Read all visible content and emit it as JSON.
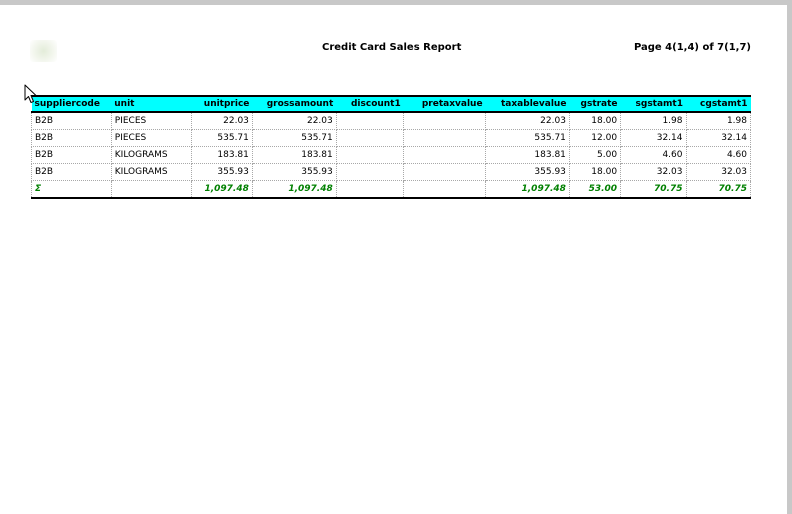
{
  "report": {
    "title": "Credit Card Sales Report",
    "page_indicator": "Page 4(1,4) of 7(1,7)"
  },
  "table": {
    "columns": [
      {
        "key": "suppliercode",
        "label": "suppliercode",
        "align": "left"
      },
      {
        "key": "unit",
        "label": "unit",
        "align": "left"
      },
      {
        "key": "unitprice",
        "label": "unitprice",
        "align": "right"
      },
      {
        "key": "grossamount",
        "label": "grossamount",
        "align": "right"
      },
      {
        "key": "discount1",
        "label": "discount1",
        "align": "right"
      },
      {
        "key": "pretaxvalue",
        "label": "pretaxvalue",
        "align": "right"
      },
      {
        "key": "taxablevalue",
        "label": "taxablevalue",
        "align": "right"
      },
      {
        "key": "gstrate",
        "label": "gstrate",
        "align": "right"
      },
      {
        "key": "sgstamt1",
        "label": "sgstamt1",
        "align": "right"
      },
      {
        "key": "cgstamt1",
        "label": "cgstamt1",
        "align": "right"
      }
    ],
    "rows": [
      [
        "B2B",
        "PIECES",
        "22.03",
        "22.03",
        "",
        "",
        "22.03",
        "18.00",
        "1.98",
        "1.98"
      ],
      [
        "B2B",
        "PIECES",
        "535.71",
        "535.71",
        "",
        "",
        "535.71",
        "12.00",
        "32.14",
        "32.14"
      ],
      [
        "B2B",
        "KILOGRAMS",
        "183.81",
        "183.81",
        "",
        "",
        "183.81",
        "5.00",
        "4.60",
        "4.60"
      ],
      [
        "B2B",
        "KILOGRAMS",
        "355.93",
        "355.93",
        "",
        "",
        "355.93",
        "18.00",
        "32.03",
        "32.03"
      ]
    ],
    "total": [
      "Σ",
      "",
      "1,097.48",
      "1,097.48",
      "",
      "",
      "1,097.48",
      "53.00",
      "70.75",
      "70.75"
    ]
  },
  "colors": {
    "header_bg": "#00ffff",
    "total_text": "#008000",
    "frame_border": "#c8c8c8"
  },
  "icons": {
    "cursor": "mouse-pointer-icon",
    "logo": "company-logo"
  }
}
